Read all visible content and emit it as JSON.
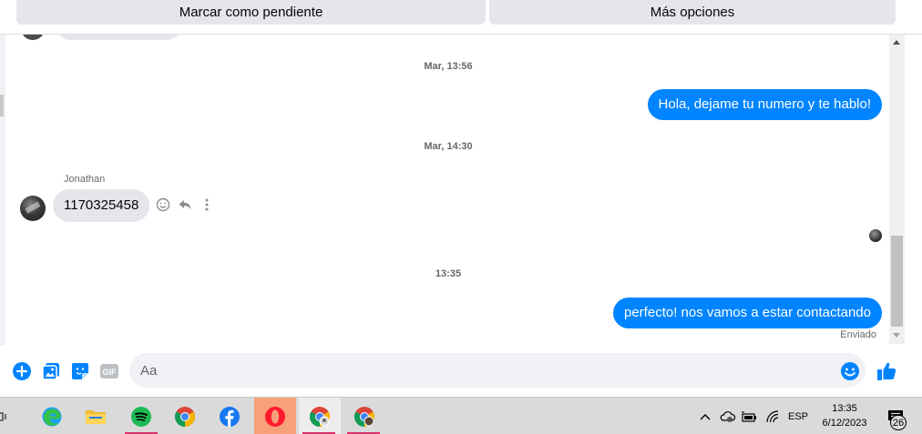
{
  "top_actions": {
    "pending_label": "Marcar como pendiente",
    "more_label": "Más opciones"
  },
  "conversation": {
    "time_separators": [
      "Mar, 13:56",
      "Mar, 14:30",
      "13:35"
    ],
    "messages": [
      {
        "direction": "outgoing",
        "text": "Hola, dejame tu numero y te hablo!"
      },
      {
        "direction": "incoming",
        "sender": "Jonathan",
        "text": "1170325458"
      },
      {
        "direction": "outgoing",
        "text": "perfecto! nos vamos a estar contactando"
      }
    ],
    "status": "Enviado"
  },
  "composer": {
    "placeholder": "Aa",
    "value": "",
    "gif_label": "GIF",
    "icons": [
      "plus-circle-icon",
      "photo-icon",
      "sticker-icon",
      "gif-icon",
      "emoji-icon",
      "like-icon"
    ]
  },
  "taskbar": {
    "apps": [
      {
        "name": "edge",
        "icon": "edge-icon"
      },
      {
        "name": "file-explorer",
        "icon": "folder-icon"
      },
      {
        "name": "spotify",
        "icon": "spotify-icon",
        "running": true
      },
      {
        "name": "chrome",
        "icon": "chrome-icon"
      },
      {
        "name": "facebook",
        "icon": "facebook-icon"
      },
      {
        "name": "opera",
        "icon": "opera-icon",
        "active": true
      },
      {
        "name": "chrome-profile-1",
        "icon": "chrome-icon",
        "running": true
      },
      {
        "name": "chrome-profile-2",
        "icon": "chrome-icon",
        "running": true
      }
    ],
    "tray": {
      "language": "ESP",
      "time": "13:35",
      "date": "6/12/2023",
      "notification_count": "26"
    }
  },
  "colors": {
    "messenger_blue": "#0084ff",
    "bubble_gray": "#e4e6eb",
    "taskbar_bg": "#dadada",
    "opera_active": "#f7a07a",
    "running_underline": "#d6336c"
  }
}
